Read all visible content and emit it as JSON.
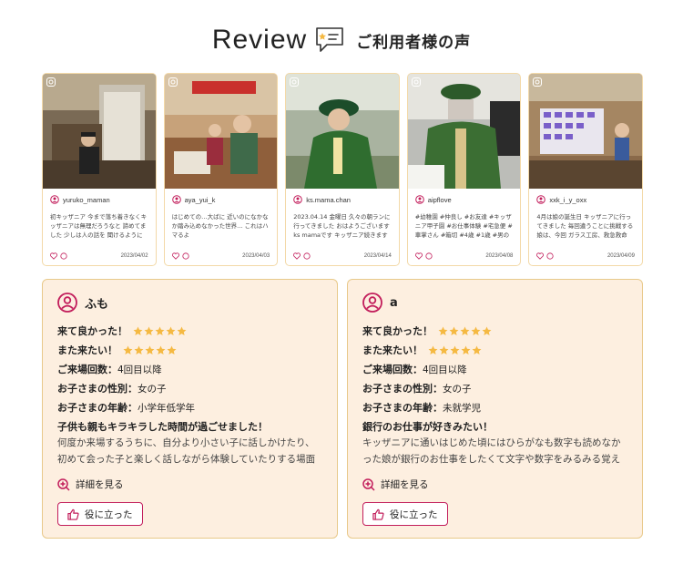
{
  "header": {
    "title": "Review",
    "subtitle": "ご利用者様の声"
  },
  "colors": {
    "accent": "#c21d5b",
    "star": "#f5b942",
    "card_bg": "#fdefe0",
    "card_border": "#e8c98a"
  },
  "instagram_posts": [
    {
      "username": "yuruko_maman",
      "text": "初キッザニア 今まで落ち着きなくキッザニアは無理だろうなと 諦めてました 少しは人の話を 聞けるようになってきたので",
      "date": "2023/04/02",
      "photo_alt": "child in uniform at reception desk"
    },
    {
      "username": "aya_yui_k",
      "text": "はじめての…大ばに 近いのになかなか踏み込めなかった世界… これはハマるよ",
      "date": "2023/04/03",
      "photo_alt": "children at shop counter"
    },
    {
      "username": "ks.mama.chan",
      "text": "2023.04.14 金曜日 久々の朝ランに行ってきました おはようございます ks mamaです キッザニア続きます 3つ目は",
      "date": "2023/04/14",
      "photo_alt": "child in green uniform"
    },
    {
      "username": "aipflove",
      "text": "#幼稚園 #仲良し #お友達 #キッザニア甲子園 #お仕事体験 #宅急便 #車掌さん #箱切 #4歳 #1歳 #男の子 #兄弟 #習",
      "date": "2023/04/08",
      "photo_alt": "child in delivery uniform"
    },
    {
      "username": "xxk_i_y_oxx",
      "text": "4月は娘の誕生日 キッザニアに行ってきました 毎回違うことに挑戦する娘は、今回 ガラス工房、救急救命士、消防署",
      "date": "2023/04/09",
      "photo_alt": "children at glass workshop"
    }
  ],
  "reviews": [
    {
      "user": "ふも",
      "came_good_label": "来て良かった！",
      "came_good_stars": 5,
      "again_label": "また来たい！",
      "again_stars": 5,
      "visits_label": "ご来場回数：",
      "visits_value": "4回目以降",
      "gender_label": "お子さまの性別：",
      "gender_value": "女の子",
      "age_label": "お子さまの年齢：",
      "age_value": "小学年低学年",
      "headline": "子供も親もキラキラした時間が過ごせました！",
      "body": "何度か来場するうちに、自分より小さい子に話しかけたり、初めて会った子と楽しく話しながら体験していたりする場面を見て成",
      "detail_label": "詳細を見る",
      "helpful_label": "役に立った"
    },
    {
      "user": "a",
      "came_good_label": "来て良かった！",
      "came_good_stars": 5,
      "again_label": "また来たい！",
      "again_stars": 5,
      "visits_label": "ご来場回数：",
      "visits_value": "4回目以降",
      "gender_label": "お子さまの性別：",
      "gender_value": "女の子",
      "age_label": "お子さまの年齢：",
      "age_value": "未就学児",
      "headline": "銀行のお仕事が好きみたい！",
      "body": "キッザニアに通いはじめた頃にはひらがなも数字も読めなかった娘が銀行のお仕事をしたくて文字や数字をみるみる覚えていきま",
      "detail_label": "詳細を見る",
      "helpful_label": "役に立った"
    }
  ]
}
